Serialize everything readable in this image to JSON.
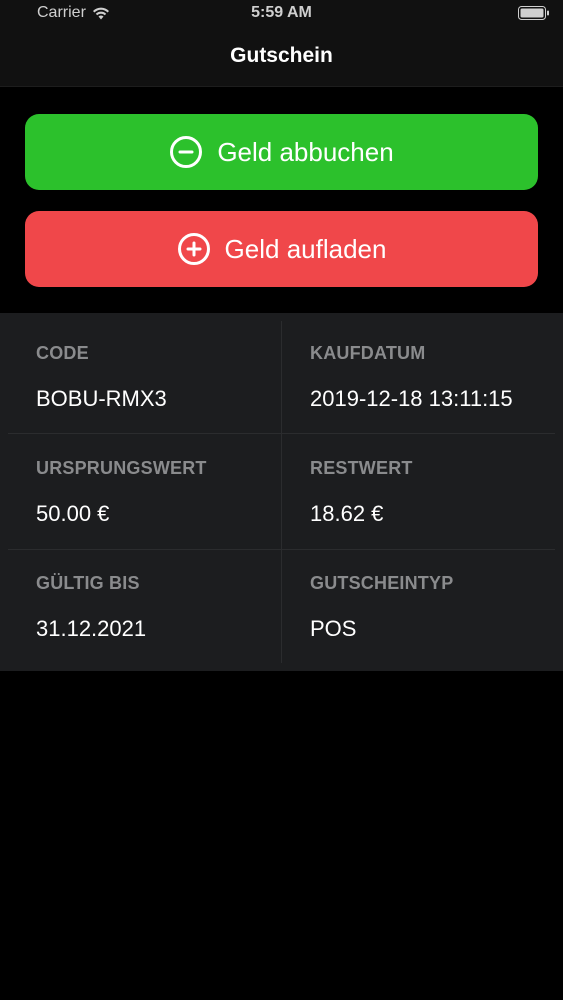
{
  "status_bar": {
    "carrier": "Carrier",
    "time": "5:59 AM"
  },
  "nav": {
    "title": "Gutschein"
  },
  "actions": {
    "debit_label": "Geld abbuchen",
    "credit_label": "Geld aufladen",
    "debit_color": "#2cc12c",
    "credit_color": "#f0474a"
  },
  "details": {
    "code": {
      "label": "CODE",
      "value": "BOBU-RMX3"
    },
    "purchase_date": {
      "label": "KAUFDATUM",
      "value": "2019-12-18 13:11:15"
    },
    "original_value": {
      "label": "URSPRUNGSWERT",
      "value": "50.00 €"
    },
    "remaining_value": {
      "label": "RESTWERT",
      "value": "18.62 €"
    },
    "valid_until": {
      "label": "GÜLTIG BIS",
      "value": "31.12.2021"
    },
    "voucher_type": {
      "label": "GUTSCHEINTYP",
      "value": "POS"
    }
  }
}
